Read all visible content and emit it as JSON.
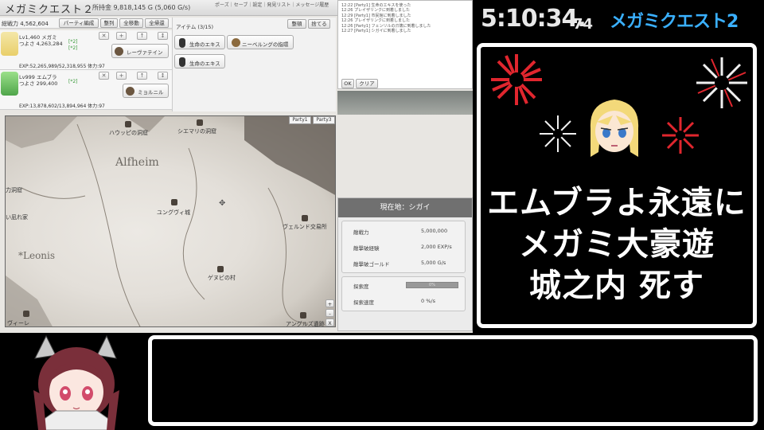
{
  "game": {
    "title": "メガミクエスト２",
    "gold": "所持金 9,818,145 G (5,060 G/s)",
    "menu": "ポーズ｜セーブ｜設定｜発見リスト｜メッセージ履歴",
    "power_label": "総戦力 4,562,604",
    "toolbar": [
      "パーティ編成",
      "整列",
      "全移動",
      "全帰還"
    ],
    "members": [
      {
        "level_name": "Lv1,460 メガミ",
        "hp": "つよさ 4,263,284",
        "star1": "[*2]",
        "star2": "[*2]",
        "exp": "EXP:52,265,989/52,318,955 体力:97",
        "equip": "レーヴァテイン"
      },
      {
        "level_name": "Lv999 エムブラ",
        "hp": "つよさ 299,400",
        "star1": "[*2]",
        "star2": "",
        "exp": "EXP:13,878,602/13,894,964 体力:97",
        "equip": "ミョルニル"
      }
    ],
    "member_buttons": [
      "✕",
      "+",
      "↑",
      "↕"
    ],
    "items_label": "アイテム (3/15)",
    "item_sort": "整頓",
    "item_discard": "捨てる",
    "items": [
      "生命のエキス",
      "ニーベルングの指環",
      "生命のエキス"
    ],
    "log": [
      "12:22 [Party1] 生命のエキスを使った",
      "12:26 プレイザリンクに到着しました",
      "12:29 [Party1] 市民館に到着しました",
      "12:26 プレイザリンクに到着しました",
      "12:26 [Party1] フェンリルの爪壊に到着しました",
      "12:27 [Party1] シガイに到着しました"
    ],
    "log_ok": "OK",
    "log_clear": "クリア",
    "map": {
      "tabs": [
        "Party1",
        "Party3"
      ],
      "regions": [
        "Alfheim",
        "*Leonis"
      ],
      "places": [
        "ハウッピの洞窟",
        "シエマリの洞窟",
        "ユングヴィ城",
        "ヴェルンド交易所",
        "ゲヌビの村",
        "アングルズ遺跡",
        "ヴィーレ",
        "力洞窟",
        "い凪れ家"
      ],
      "zoom": [
        "+",
        "-",
        "X"
      ]
    },
    "location": {
      "title": "現在地：シガイ",
      "rows": [
        {
          "k": "敵戦力",
          "v": "5,000,000"
        },
        {
          "k": "敵撃破経験",
          "v": "2,000 EXP/s"
        },
        {
          "k": "敵撃破ゴールド",
          "v": "5,000 G/s"
        }
      ],
      "explore_label": "探索度",
      "explore_value": "0%",
      "explore_progress": 0,
      "speed_label": "探索速度",
      "speed_value": "0 %/s"
    }
  },
  "overlay": {
    "timer_main": "5:10:34.",
    "timer_ms": "74",
    "game_name": "メガミクエスト2",
    "comment_lines": [
      "エムブラよ永遠に",
      "メガミ大豪遊",
      "城之内 死す"
    ],
    "colors": {
      "timer": "#e8e8e8",
      "game_name": "#3ab0ff",
      "firework_red": "#e0262e",
      "box_border": "#ffffff"
    }
  }
}
